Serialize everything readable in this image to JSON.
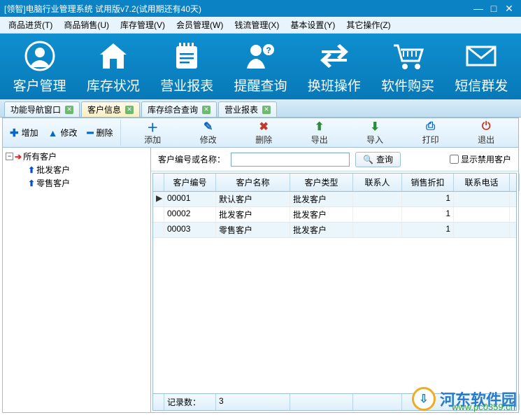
{
  "window": {
    "title": "[领智]电脑行业管理系统 试用版v7.2(试用期还有40天)"
  },
  "menubar": [
    "商品进货(T)",
    "商品销售(U)",
    "库存管理(V)",
    "会员管理(W)",
    "钱流管理(X)",
    "基本设置(Y)",
    "其它操作(Z)"
  ],
  "bigToolbar": [
    {
      "label": "客户管理",
      "icon": "user-circle"
    },
    {
      "label": "库存状况",
      "icon": "house"
    },
    {
      "label": "营业报表",
      "icon": "notepad"
    },
    {
      "label": "提醒查询",
      "icon": "person-help"
    },
    {
      "label": "换班操作",
      "icon": "swap"
    },
    {
      "label": "软件购买",
      "icon": "cart"
    },
    {
      "label": "短信群发",
      "icon": "envelope"
    }
  ],
  "tabs": [
    {
      "label": "功能导航窗口",
      "active": false
    },
    {
      "label": "客户信息",
      "active": true
    },
    {
      "label": "库存综合查询",
      "active": false
    },
    {
      "label": "营业报表",
      "active": false
    }
  ],
  "leftTools": {
    "add": "增加",
    "edit": "修改",
    "del": "删除"
  },
  "rightTools": [
    {
      "label": "添加",
      "color": "#0a66c2",
      "glyph": "＋"
    },
    {
      "label": "修改",
      "color": "#0a66c2",
      "glyph": "✎"
    },
    {
      "label": "删除",
      "color": "#c0392b",
      "glyph": "✖"
    },
    {
      "label": "导出",
      "color": "#2e8b3d",
      "glyph": "⇧"
    },
    {
      "label": "导入",
      "color": "#2e8b3d",
      "glyph": "⇩"
    },
    {
      "label": "打印",
      "color": "#0a66c2",
      "glyph": "⎙"
    },
    {
      "label": "退出",
      "color": "#c0392b",
      "glyph": "⏻"
    }
  ],
  "tree": {
    "root": "所有客户",
    "children": [
      "批发客户",
      "零售客户"
    ]
  },
  "search": {
    "label": "客户编号或名称：",
    "value": "",
    "button": "查询",
    "checkbox": "显示禁用客户"
  },
  "columns": [
    "客户编号",
    "客户名称",
    "客户类型",
    "联系人",
    "销售折扣",
    "联系电话"
  ],
  "rows": [
    {
      "id": "00001",
      "name": "默认客户",
      "type": "批发客户",
      "contact": "",
      "discount": "1",
      "phone": "",
      "current": true
    },
    {
      "id": "00002",
      "name": "批发客户",
      "type": "批发客户",
      "contact": "",
      "discount": "1",
      "phone": "",
      "current": false
    },
    {
      "id": "00003",
      "name": "零售客户",
      "type": "批发客户",
      "contact": "",
      "discount": "1",
      "phone": "",
      "current": false
    }
  ],
  "footer": {
    "label": "记录数：",
    "count": "3"
  },
  "watermark": {
    "text": "河东软件园",
    "url": "www.pc0359.cn"
  }
}
